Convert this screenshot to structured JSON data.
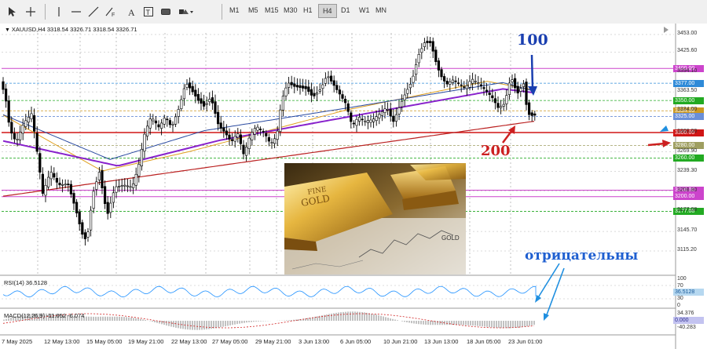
{
  "toolbar": {
    "timeframes": [
      "M1",
      "M5",
      "M15",
      "M30",
      "H1",
      "H4",
      "D1",
      "W1",
      "MN"
    ],
    "active_timeframe": "H4",
    "icons": [
      "cursor-icon",
      "crosshair-icon",
      "horizontal-line-icon",
      "trend-line-icon",
      "fibonacci-icon",
      "text-icon",
      "label-icon",
      "rectangle-icon",
      "shapes-icon"
    ]
  },
  "chart_header": "XAUUSD,H4   3318.54 3326.71 3318.54 3326.71",
  "price_scale": [
    "3453.00",
    "3425.60",
    "3394.10",
    "3363.50",
    "3334.00",
    "3300.00",
    "3269.90",
    "3239.30",
    "3208.80",
    "3177.08",
    "3145.70",
    "3115.20"
  ],
  "level_labels": [
    {
      "text": "3400.00",
      "color": "#cc44cc"
    },
    {
      "text": "3377.00",
      "color": "#2e8ad8"
    },
    {
      "text": "3350.00",
      "color": "#22aa22"
    },
    {
      "text": "3334.00",
      "color": "#cc9922"
    },
    {
      "text": "3325.00",
      "color": "#6a8fd8"
    },
    {
      "text": "3300.00",
      "color": "#d01515"
    },
    {
      "text": "3280.00",
      "color": "#9e9e60"
    },
    {
      "text": "3260.00",
      "color": "#22aa22"
    },
    {
      "text": "3210.00",
      "color": "#cc44cc"
    },
    {
      "text": "3200.00",
      "color": "#cc44cc"
    },
    {
      "text": "3177.08",
      "color": "#22aa22"
    }
  ],
  "rsi": {
    "label": "RSI(14) 36.5128",
    "scale": [
      "100",
      "70",
      "30",
      "0"
    ],
    "current": "36.5128"
  },
  "macd": {
    "label": "MACD(12,26,9) -11.052 -6.074",
    "scale": [
      "34.376",
      "0.000",
      "-40.283"
    ]
  },
  "x_axis": [
    "7 May 2025",
    "12 May 13:00",
    "15 May 05:00",
    "19 May 21:00",
    "22 May 13:00",
    "27 May 05:00",
    "29 May 21:00",
    "3 Jun 13:00",
    "6 Jun 05:00",
    "10 Jun 21:00",
    "13 Jun 13:00",
    "18 Jun 05:00",
    "23 Jun 01:00"
  ],
  "annotations": {
    "ma100": "100",
    "ma200": "200",
    "negative": "отрицательны"
  },
  "colors": {
    "ma100": "#8822cc",
    "ma200": "#bb2222",
    "ma50": "#2a4aa0",
    "ma_orange": "#e0a020",
    "candle": "#000000",
    "annotation_blue": "#1a3fb0",
    "annotation_red": "#cc2020",
    "arrow_light": "#1f8fe0"
  }
}
